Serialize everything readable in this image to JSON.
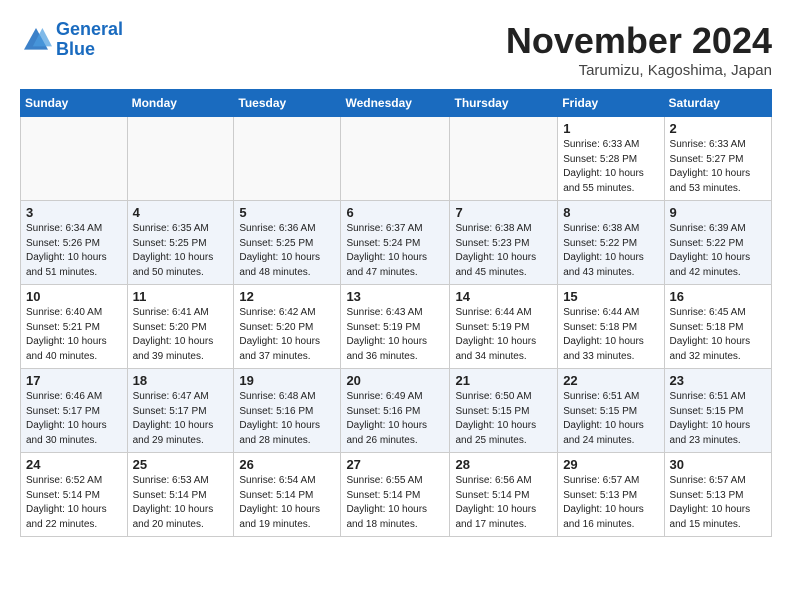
{
  "header": {
    "logo_line1": "General",
    "logo_line2": "Blue",
    "month": "November 2024",
    "location": "Tarumizu, Kagoshima, Japan"
  },
  "weekdays": [
    "Sunday",
    "Monday",
    "Tuesday",
    "Wednesday",
    "Thursday",
    "Friday",
    "Saturday"
  ],
  "weeks": [
    [
      {
        "day": "",
        "text": ""
      },
      {
        "day": "",
        "text": ""
      },
      {
        "day": "",
        "text": ""
      },
      {
        "day": "",
        "text": ""
      },
      {
        "day": "",
        "text": ""
      },
      {
        "day": "1",
        "text": "Sunrise: 6:33 AM\nSunset: 5:28 PM\nDaylight: 10 hours\nand 55 minutes."
      },
      {
        "day": "2",
        "text": "Sunrise: 6:33 AM\nSunset: 5:27 PM\nDaylight: 10 hours\nand 53 minutes."
      }
    ],
    [
      {
        "day": "3",
        "text": "Sunrise: 6:34 AM\nSunset: 5:26 PM\nDaylight: 10 hours\nand 51 minutes."
      },
      {
        "day": "4",
        "text": "Sunrise: 6:35 AM\nSunset: 5:25 PM\nDaylight: 10 hours\nand 50 minutes."
      },
      {
        "day": "5",
        "text": "Sunrise: 6:36 AM\nSunset: 5:25 PM\nDaylight: 10 hours\nand 48 minutes."
      },
      {
        "day": "6",
        "text": "Sunrise: 6:37 AM\nSunset: 5:24 PM\nDaylight: 10 hours\nand 47 minutes."
      },
      {
        "day": "7",
        "text": "Sunrise: 6:38 AM\nSunset: 5:23 PM\nDaylight: 10 hours\nand 45 minutes."
      },
      {
        "day": "8",
        "text": "Sunrise: 6:38 AM\nSunset: 5:22 PM\nDaylight: 10 hours\nand 43 minutes."
      },
      {
        "day": "9",
        "text": "Sunrise: 6:39 AM\nSunset: 5:22 PM\nDaylight: 10 hours\nand 42 minutes."
      }
    ],
    [
      {
        "day": "10",
        "text": "Sunrise: 6:40 AM\nSunset: 5:21 PM\nDaylight: 10 hours\nand 40 minutes."
      },
      {
        "day": "11",
        "text": "Sunrise: 6:41 AM\nSunset: 5:20 PM\nDaylight: 10 hours\nand 39 minutes."
      },
      {
        "day": "12",
        "text": "Sunrise: 6:42 AM\nSunset: 5:20 PM\nDaylight: 10 hours\nand 37 minutes."
      },
      {
        "day": "13",
        "text": "Sunrise: 6:43 AM\nSunset: 5:19 PM\nDaylight: 10 hours\nand 36 minutes."
      },
      {
        "day": "14",
        "text": "Sunrise: 6:44 AM\nSunset: 5:19 PM\nDaylight: 10 hours\nand 34 minutes."
      },
      {
        "day": "15",
        "text": "Sunrise: 6:44 AM\nSunset: 5:18 PM\nDaylight: 10 hours\nand 33 minutes."
      },
      {
        "day": "16",
        "text": "Sunrise: 6:45 AM\nSunset: 5:18 PM\nDaylight: 10 hours\nand 32 minutes."
      }
    ],
    [
      {
        "day": "17",
        "text": "Sunrise: 6:46 AM\nSunset: 5:17 PM\nDaylight: 10 hours\nand 30 minutes."
      },
      {
        "day": "18",
        "text": "Sunrise: 6:47 AM\nSunset: 5:17 PM\nDaylight: 10 hours\nand 29 minutes."
      },
      {
        "day": "19",
        "text": "Sunrise: 6:48 AM\nSunset: 5:16 PM\nDaylight: 10 hours\nand 28 minutes."
      },
      {
        "day": "20",
        "text": "Sunrise: 6:49 AM\nSunset: 5:16 PM\nDaylight: 10 hours\nand 26 minutes."
      },
      {
        "day": "21",
        "text": "Sunrise: 6:50 AM\nSunset: 5:15 PM\nDaylight: 10 hours\nand 25 minutes."
      },
      {
        "day": "22",
        "text": "Sunrise: 6:51 AM\nSunset: 5:15 PM\nDaylight: 10 hours\nand 24 minutes."
      },
      {
        "day": "23",
        "text": "Sunrise: 6:51 AM\nSunset: 5:15 PM\nDaylight: 10 hours\nand 23 minutes."
      }
    ],
    [
      {
        "day": "24",
        "text": "Sunrise: 6:52 AM\nSunset: 5:14 PM\nDaylight: 10 hours\nand 22 minutes."
      },
      {
        "day": "25",
        "text": "Sunrise: 6:53 AM\nSunset: 5:14 PM\nDaylight: 10 hours\nand 20 minutes."
      },
      {
        "day": "26",
        "text": "Sunrise: 6:54 AM\nSunset: 5:14 PM\nDaylight: 10 hours\nand 19 minutes."
      },
      {
        "day": "27",
        "text": "Sunrise: 6:55 AM\nSunset: 5:14 PM\nDaylight: 10 hours\nand 18 minutes."
      },
      {
        "day": "28",
        "text": "Sunrise: 6:56 AM\nSunset: 5:14 PM\nDaylight: 10 hours\nand 17 minutes."
      },
      {
        "day": "29",
        "text": "Sunrise: 6:57 AM\nSunset: 5:13 PM\nDaylight: 10 hours\nand 16 minutes."
      },
      {
        "day": "30",
        "text": "Sunrise: 6:57 AM\nSunset: 5:13 PM\nDaylight: 10 hours\nand 15 minutes."
      }
    ]
  ]
}
